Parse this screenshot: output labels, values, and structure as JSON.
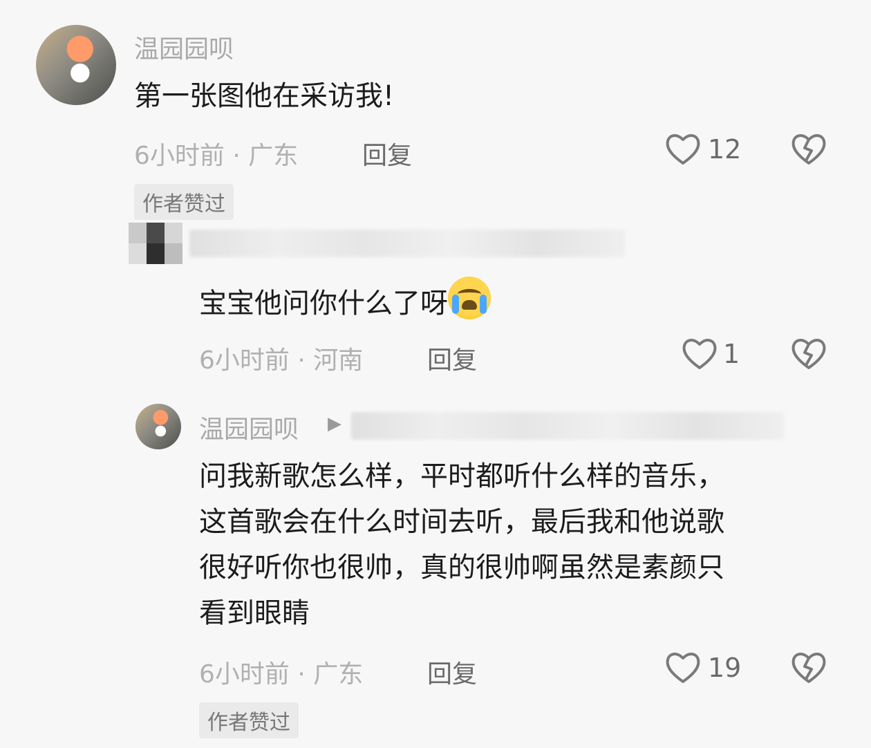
{
  "comments": [
    {
      "username": "温园园呗",
      "text": "第一张图他在采访我!",
      "time_location": "6小时前 · 广东",
      "reply_label": "回复",
      "likes": "12",
      "badge": "作者赞过"
    },
    {
      "text": "宝宝他问你什么了呀",
      "time_location": "6小时前 · 河南",
      "reply_label": "回复",
      "likes": "1"
    },
    {
      "username": "温园园呗",
      "text_lines": [
        "问我新歌怎么样，平时都听什么样的音乐，",
        "这首歌会在什么时间去听，最后我和他说歌",
        "很好听你也很帅，真的很帅啊虽然是素颜只",
        "看到眼睛"
      ],
      "time_location": "6小时前 · 广东",
      "reply_label": "回复",
      "likes": "19",
      "badge": "作者赞过"
    }
  ],
  "icons": {
    "like": "heart-outline-icon",
    "dislike": "broken-heart-icon",
    "reply_arrow": "play-triangle-icon",
    "emoji": "loudly-crying-face-emoji"
  }
}
